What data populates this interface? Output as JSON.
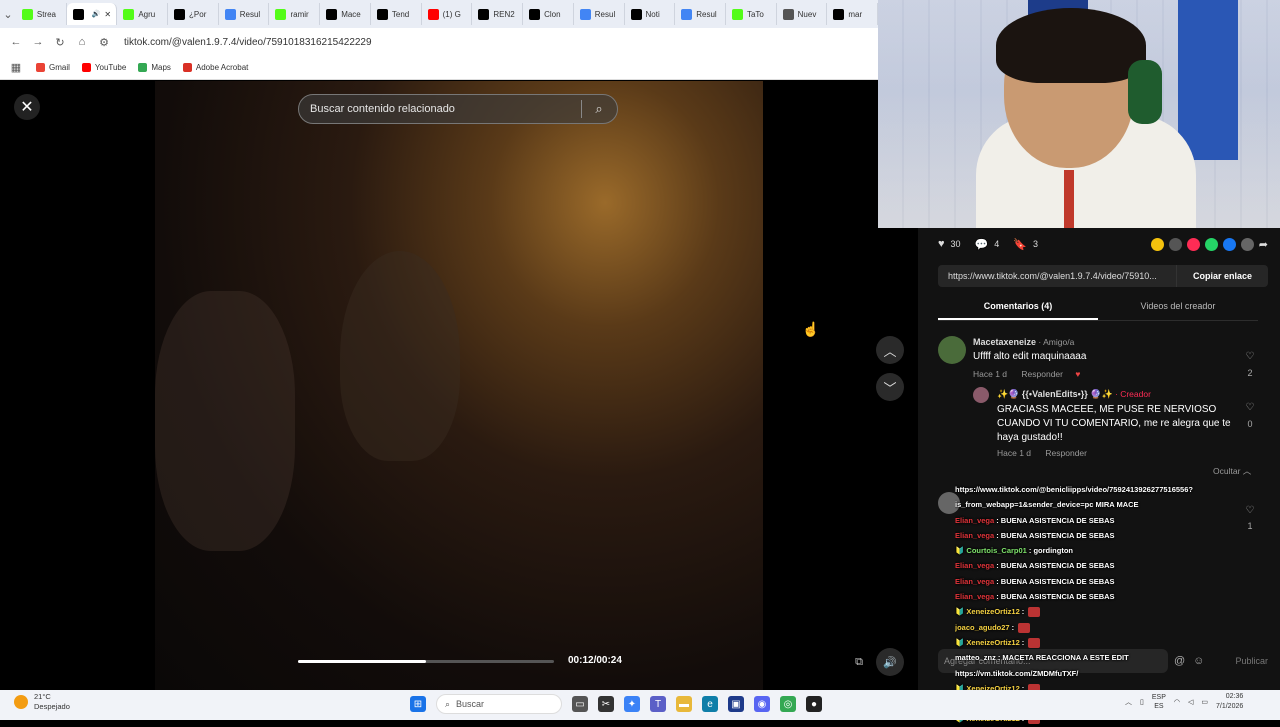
{
  "browser": {
    "tabs": [
      {
        "label": "Strea",
        "icon": "kick-icon",
        "color": "#53fc18",
        "active": false
      },
      {
        "label": "",
        "icon": "tiktok-icon",
        "color": "#000000",
        "active": true
      },
      {
        "label": "Agru",
        "icon": "kick-icon",
        "color": "#53fc18",
        "active": false
      },
      {
        "label": "¿Por",
        "icon": "x-icon",
        "color": "#000000",
        "active": false
      },
      {
        "label": "Resul",
        "icon": "google-icon",
        "color": "#4285f4",
        "active": false
      },
      {
        "label": "ramir",
        "icon": "kick-icon",
        "color": "#53fc18",
        "active": false
      },
      {
        "label": "Mace",
        "icon": "tiktok-icon",
        "color": "#000000",
        "active": false
      },
      {
        "label": "Tend",
        "icon": "x-icon",
        "color": "#000000",
        "active": false
      },
      {
        "label": "(1) G",
        "icon": "youtube-icon",
        "color": "#ff0000",
        "active": false
      },
      {
        "label": "REN2",
        "icon": "x-icon",
        "color": "#000000",
        "active": false
      },
      {
        "label": "Clon",
        "icon": "x-icon",
        "color": "#000000",
        "active": false
      },
      {
        "label": "Resul",
        "icon": "google-icon",
        "color": "#4285f4",
        "active": false
      },
      {
        "label": "Noti",
        "icon": "x-icon",
        "color": "#000000",
        "active": false
      },
      {
        "label": "Resul",
        "icon": "google-icon",
        "color": "#4285f4",
        "active": false
      },
      {
        "label": "TaTo",
        "icon": "kick-icon",
        "color": "#53fc18",
        "active": false
      },
      {
        "label": "Nuev",
        "icon": "chrome-icon",
        "color": "#555555",
        "active": false
      },
      {
        "label": "mar",
        "icon": "x-icon",
        "color": "#000000",
        "active": false
      }
    ],
    "url": "tiktok.com/@valen1.9.7.4/video/7591018316215422229",
    "bookmarks": [
      {
        "label": "Gmail",
        "color": "#ea4335"
      },
      {
        "label": "YouTube",
        "color": "#ff0000"
      },
      {
        "label": "Maps",
        "color": "#34a853"
      },
      {
        "label": "Adobe Acrobat",
        "color": "#d93025"
      }
    ]
  },
  "viewer": {
    "close_glyph": "✕",
    "search_placeholder": "Buscar contenido relacionado",
    "search_icon_glyph": "⌕",
    "nav_up_glyph": "︿",
    "nav_down_glyph": "﹀",
    "progress_fraction": 0.5,
    "time": "00:12/00:24"
  },
  "panel": {
    "likes": "30",
    "comments": "4",
    "saves": "3",
    "share_colors": [
      "#f4c20d",
      "#555555",
      "#fe2c55",
      "#25d366",
      "#1877f2",
      "#666666"
    ],
    "link": "https://www.tiktok.com/@valen1.9.7.4/video/75910...",
    "copy_label": "Copiar enlace",
    "tab_comments": "Comentarios (4)",
    "tab_creator": "Videos del creador",
    "comment1": {
      "user": "Macetaxeneize",
      "tag": " · Amigo/a",
      "text": "Uffff alto edit maquinaaaa",
      "time": "Hace 1 d",
      "reply": "Responder",
      "likes": "2"
    },
    "reply1": {
      "user": "✨🔮 {{•ValenEdits•}} 🔮✨",
      "tag": " · Creador",
      "text": "GRACIASS MACEEE, ME PUSE RE NERVIOSO CUANDO VI TU COMENTARIO, me re alegra que te haya gustado!!",
      "time": "Hace 1 d",
      "reply": "Responder",
      "likes": "0"
    },
    "hide_label": "Ocultar ︿",
    "comment2_likes": "1",
    "input_placeholder": "Agregar comentario...",
    "publish": "Publicar"
  },
  "chat": [
    {
      "user": "",
      "color": "#ffffff",
      "msg": "https://www.tiktok.com/@benicliipps/video/7592413926277516556?"
    },
    {
      "user": "",
      "color": "#ffffff",
      "msg": "is_from_webapp=1&sender_device=pc MIRA MACE"
    },
    {
      "user": "Elian_vega",
      "color": "#e0343a",
      "msg": ": BUENA ASISTENCIA DE SEBAS"
    },
    {
      "user": "Elian_vega",
      "color": "#e0343a",
      "msg": ": BUENA ASISTENCIA DE SEBAS"
    },
    {
      "user": "🔰 Courtois_Carp01",
      "color": "#7ee36b",
      "msg": ": gordington"
    },
    {
      "user": "Elian_vega",
      "color": "#e0343a",
      "msg": ": BUENA ASISTENCIA DE SEBAS"
    },
    {
      "user": "Elian_vega",
      "color": "#e0343a",
      "msg": ": BUENA ASISTENCIA DE SEBAS"
    },
    {
      "user": "Elian_vega",
      "color": "#e0343a",
      "msg": ": BUENA ASISTENCIA DE SEBAS"
    },
    {
      "user": "🔰 XeneizeOrtiz12",
      "color": "#f5d142",
      "msg": ":",
      "emote": true
    },
    {
      "user": "joaco_agudo27",
      "color": "#f5d142",
      "msg": ":",
      "emote": true
    },
    {
      "user": "🔰 XeneizeOrtiz12",
      "color": "#f5d142",
      "msg": ":",
      "emote": true
    },
    {
      "user": "matteo_znz",
      "color": "#ffffff",
      "msg": ": MACETA REACCIONA A ESTE EDIT"
    },
    {
      "user": "",
      "color": "#ffffff",
      "msg": "https://vm.tiktok.com/ZMDMfuTXF/"
    },
    {
      "user": "🔰 XeneizeOrtiz12",
      "color": "#f5d142",
      "msg": ":",
      "emote": true
    },
    {
      "user": "🔰 XeneizeOrtiz12",
      "color": "#f5d142",
      "msg": ":",
      "emote": true
    },
    {
      "user": "🔰 XeneizeOrtiz12",
      "color": "#f5d142",
      "msg": ":",
      "emote": true
    }
  ],
  "taskbar": {
    "temp": "21°C",
    "weather": "Despejado",
    "search_label": "Buscar",
    "lang1": "ESP",
    "lang2": "ES",
    "time": "02:36",
    "date": "7/1/2026"
  }
}
